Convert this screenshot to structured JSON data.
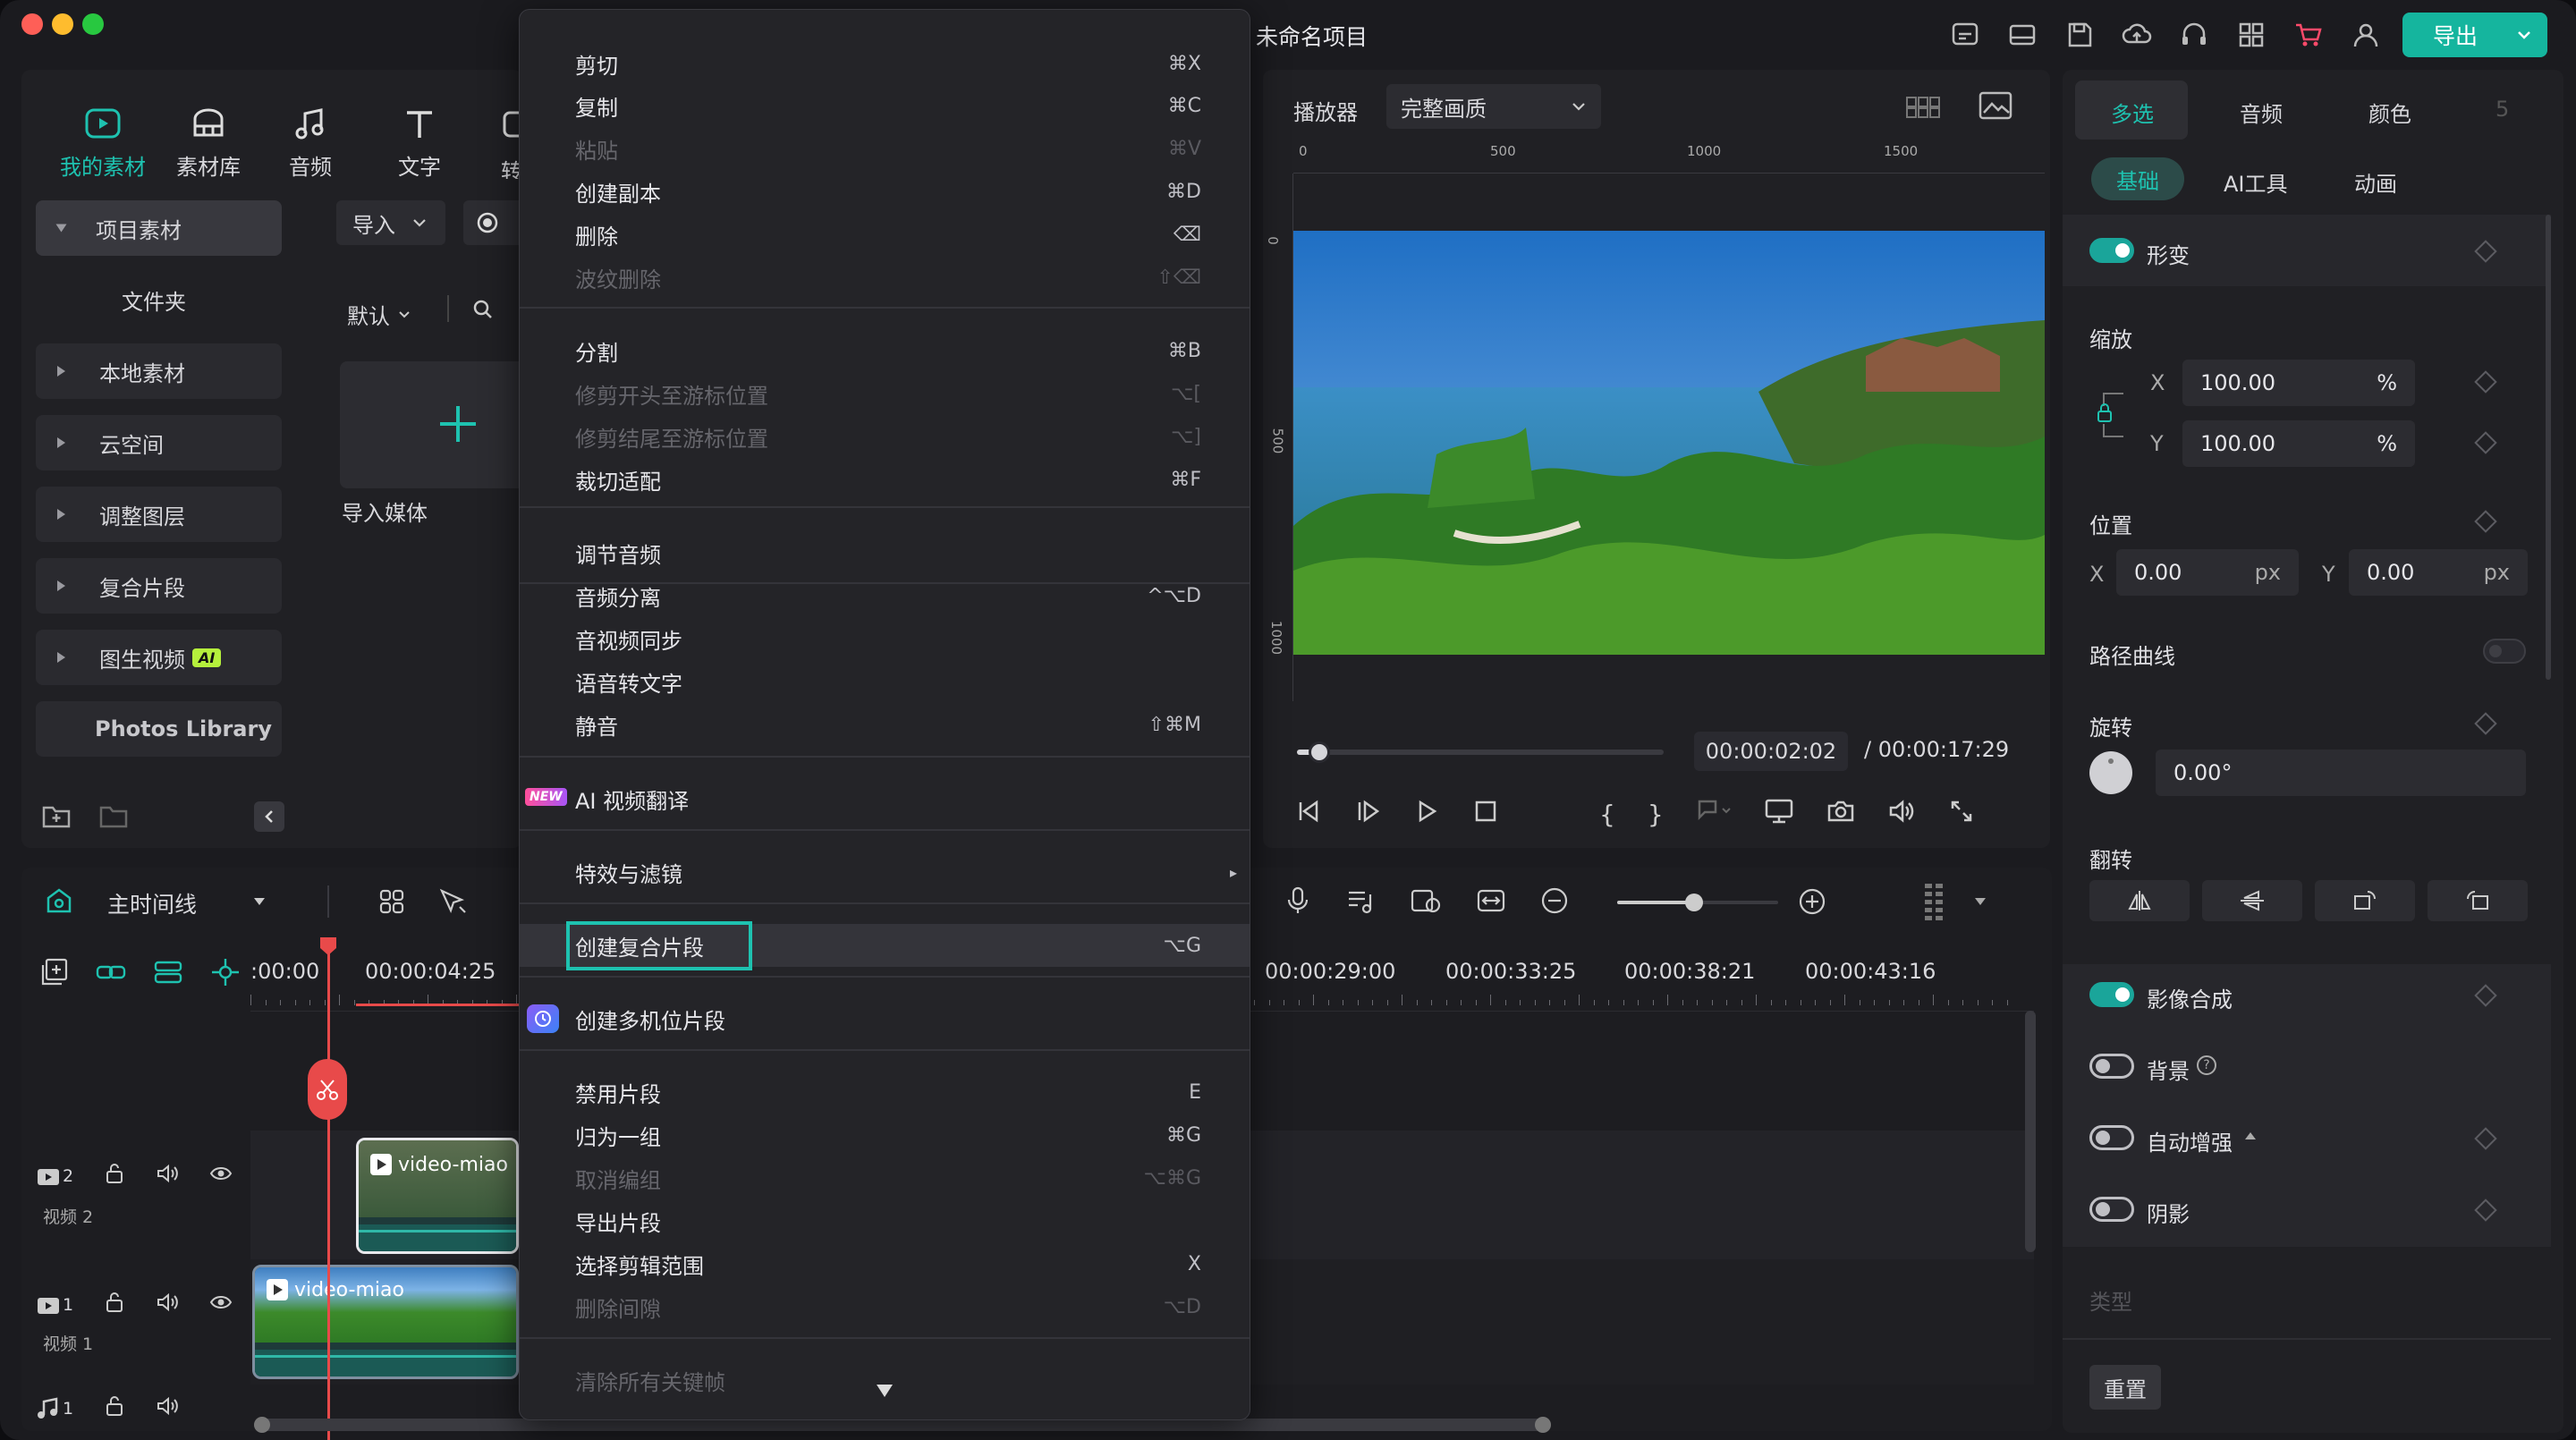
{
  "window": {
    "title": "未命名项目",
    "export_label": "导出"
  },
  "library_tabs": [
    {
      "label": "我的素材",
      "icon": "my-media-icon",
      "active": true
    },
    {
      "label": "素材库",
      "icon": "stock-library-icon"
    },
    {
      "label": "音频",
      "icon": "music-note-icon"
    },
    {
      "label": "文字",
      "icon": "text-icon"
    },
    {
      "label": "转",
      "icon": "transition-icon"
    }
  ],
  "sidebar": {
    "items": [
      {
        "label": "项目素材"
      },
      {
        "label": "文件夹"
      },
      {
        "label": "本地素材"
      },
      {
        "label": "云空间"
      },
      {
        "label": "调整图层"
      },
      {
        "label": "复合片段"
      },
      {
        "label": "图生视频",
        "badge": "AI"
      },
      {
        "label": "Photos Library"
      }
    ]
  },
  "media": {
    "import_label": "导入",
    "sort_label": "默认",
    "import_media_label": "导入媒体"
  },
  "context_menu": {
    "items": [
      {
        "label": "剪切",
        "shortcut": "⌘X"
      },
      {
        "label": "复制",
        "shortcut": "⌘C"
      },
      {
        "label": "粘贴",
        "shortcut": "⌘V",
        "disabled": true
      },
      {
        "label": "创建副本",
        "shortcut": "⌘D"
      },
      {
        "label": "删除",
        "shortcut": "⌫"
      },
      {
        "label": "波纹删除",
        "shortcut": "⇧⌫",
        "disabled": true
      },
      {
        "label": "分割",
        "shortcut": "⌘B"
      },
      {
        "label": "修剪开头至游标位置",
        "shortcut": "⌥[",
        "disabled": true
      },
      {
        "label": "修剪结尾至游标位置",
        "shortcut": "⌥]",
        "disabled": true
      },
      {
        "label": "裁切适配",
        "shortcut": "⌘F"
      },
      {
        "label": "调节音频",
        "shortcut": ""
      },
      {
        "label": "音频分离",
        "shortcut": "^⌥D"
      },
      {
        "label": "音视频同步",
        "shortcut": ""
      },
      {
        "label": "语音转文字",
        "shortcut": ""
      },
      {
        "label": "静音",
        "shortcut": "⇧⌘M"
      },
      {
        "label": "AI 视频翻译",
        "shortcut": "",
        "badge": "NEW"
      },
      {
        "label": "特效与滤镜",
        "shortcut": "▸"
      },
      {
        "label": "创建复合片段",
        "shortcut": "⌥G",
        "highlighted": true
      },
      {
        "label": "创建多机位片段",
        "shortcut": ""
      },
      {
        "label": "禁用片段",
        "shortcut": "E"
      },
      {
        "label": "归为一组",
        "shortcut": "⌘G"
      },
      {
        "label": "取消编组",
        "shortcut": "⌥⌘G",
        "disabled": true
      },
      {
        "label": "导出片段",
        "shortcut": ""
      },
      {
        "label": "选择剪辑范围",
        "shortcut": "X"
      },
      {
        "label": "删除间隙",
        "shortcut": "⌥D",
        "disabled": true
      },
      {
        "label": "清除所有关键帧",
        "shortcut": "",
        "disabled": true
      }
    ]
  },
  "player": {
    "label": "播放器",
    "quality": "完整画质",
    "ruler_h": [
      "0",
      "500",
      "1000",
      "1500"
    ],
    "ruler_v": [
      "0",
      "500",
      "1000"
    ],
    "current_time": "00:00:02:02",
    "total_time": "/ 00:00:17:29",
    "progress": 0.06
  },
  "timeline": {
    "title": "主时间线",
    "ruler_labels": [
      ":00:00",
      "00:00:04:25",
      "00:00:29:00",
      "00:00:33:25",
      "00:00:38:21",
      "00:00:43:16"
    ],
    "tracks": [
      {
        "index": "2",
        "name": "视频 2",
        "clip": "video-miao"
      },
      {
        "index": "1",
        "name": "视频 1",
        "clip": "video-miao"
      },
      {
        "index": "1",
        "name": "",
        "clip": ""
      }
    ]
  },
  "inspector": {
    "tabs": [
      "多选",
      "音频",
      "颜色"
    ],
    "subtabs": [
      "基础",
      "AI工具",
      "动画"
    ],
    "transform_label": "形变",
    "scale_label": "缩放",
    "scale_x": "100.00",
    "scale_y": "100.00",
    "percent": "%",
    "position_label": "位置",
    "pos_x": "0.00",
    "pos_y": "0.00",
    "px": "px",
    "x_label": "X",
    "y_label": "Y",
    "path_label": "路径曲线",
    "rotate_label": "旋转",
    "rotate_value": "0.00°",
    "flip_label": "翻转",
    "composite_label": "影像合成",
    "background_label": "背景",
    "auto_enhance_label": "自动增强",
    "shadow_label": "阴影",
    "type_label": "类型",
    "reset_label": "重置"
  },
  "colors": {
    "accent": "#1aa59a",
    "playhead": "#e84a4a",
    "highlight_border": "#1ec2b0"
  }
}
